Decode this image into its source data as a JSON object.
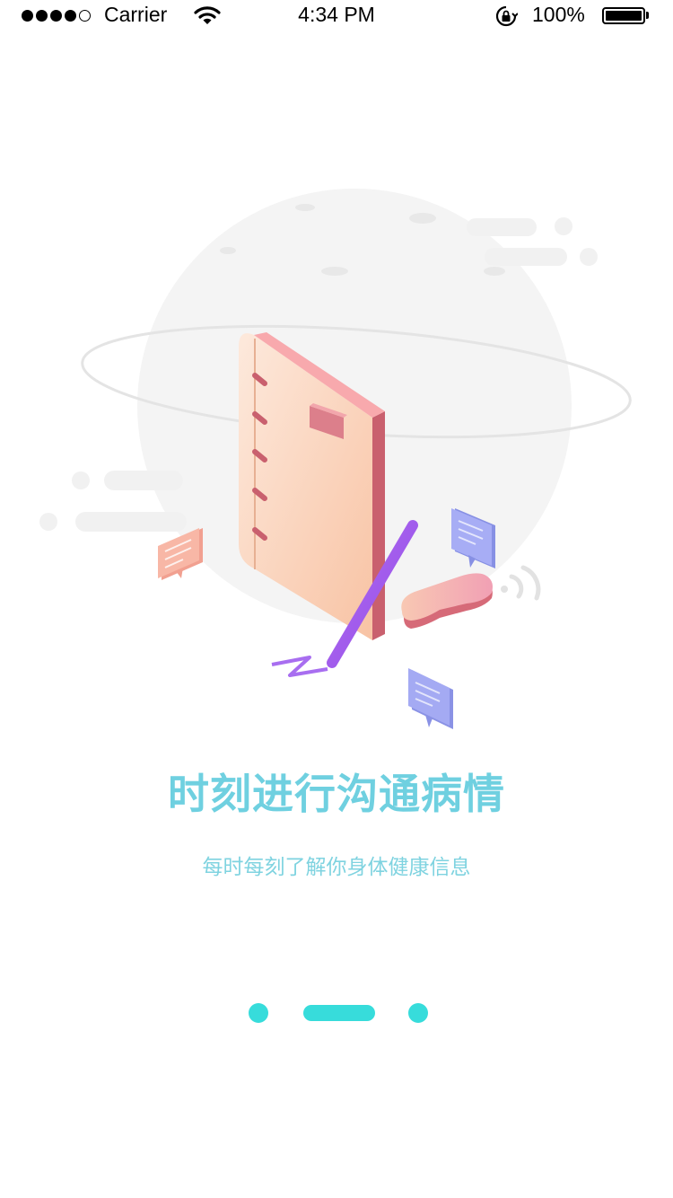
{
  "status_bar": {
    "carrier": "Carrier",
    "time": "4:34 PM",
    "battery": "100%",
    "signal_bars_filled": 4,
    "signal_bars_total": 5
  },
  "illustration": {
    "icons": [
      "planet-icon",
      "notebook-icon",
      "pen-icon",
      "phone-icon",
      "chat-bubble-icon"
    ]
  },
  "onboarding": {
    "title": "时刻进行沟通病情",
    "subtitle": "每时每刻了解你身体健康信息"
  },
  "pager": {
    "total": 3,
    "current": 2
  },
  "colors": {
    "accent": "#37dcdb",
    "title": "#6fd0e0",
    "subtitle": "#7fd3e0"
  }
}
